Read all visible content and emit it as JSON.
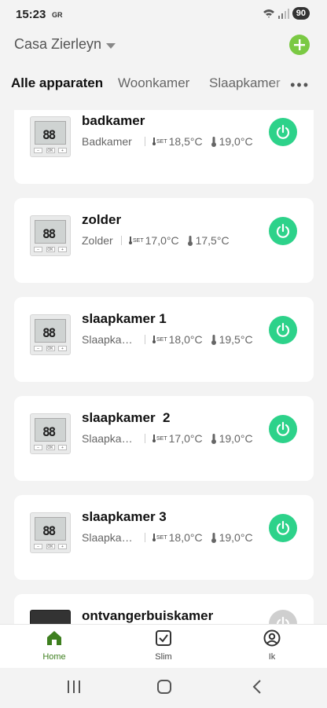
{
  "status": {
    "time": "15:23",
    "carrier": "GR",
    "battery": "90"
  },
  "header": {
    "home_name": "Casa Zierleyn"
  },
  "tabs": [
    {
      "label": "Alle apparaten",
      "active": true
    },
    {
      "label": "Woonkamer",
      "active": false
    },
    {
      "label": "Slaapkamer",
      "active": false
    }
  ],
  "thumb_display": "88",
  "thumb_buttons": [
    "–",
    "OK",
    "+"
  ],
  "devices": [
    {
      "name": "badkamer",
      "room": "Badkamer",
      "set_temp": "18,5°C",
      "current_temp": "19,0°C",
      "power": "on"
    },
    {
      "name": "zolder",
      "room": "Zolder",
      "set_temp": "17,0°C",
      "current_temp": "17,5°C",
      "power": "on"
    },
    {
      "name": "slaapkamer 1",
      "room": "Slaapkam...",
      "set_temp": "18,0°C",
      "current_temp": "19,5°C",
      "power": "on"
    },
    {
      "name": "slaapkamer  2",
      "room": "Slaapkam...",
      "set_temp": "17,0°C",
      "current_temp": "19,0°C",
      "power": "on"
    },
    {
      "name": "slaapkamer 3",
      "room": "Slaapkam...",
      "set_temp": "18,0°C",
      "current_temp": "19,0°C",
      "power": "on"
    },
    {
      "name": "ontvangerbuiskamer",
      "power": "off"
    }
  ],
  "nav": {
    "home": "Home",
    "smart": "Slim",
    "me": "Ik"
  },
  "colors": {
    "accent_green": "#2dd28a",
    "add_green": "#7ac943",
    "nav_active": "#3e7f1f"
  }
}
